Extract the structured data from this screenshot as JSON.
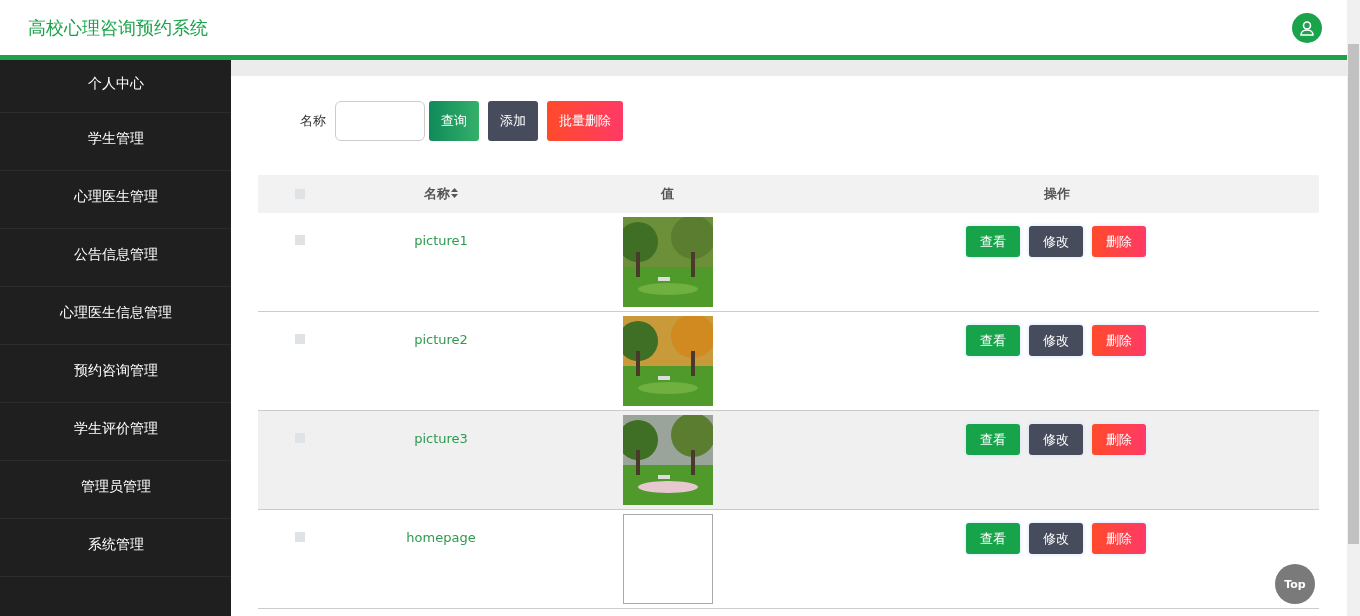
{
  "header": {
    "title": "高校心理咨询预约系统"
  },
  "sidebar": {
    "items": [
      {
        "label": "个人中心"
      },
      {
        "label": "学生管理"
      },
      {
        "label": "心理医生管理"
      },
      {
        "label": "公告信息管理"
      },
      {
        "label": "心理医生信息管理"
      },
      {
        "label": "预约咨询管理"
      },
      {
        "label": "学生评价管理"
      },
      {
        "label": "管理员管理"
      },
      {
        "label": "系统管理"
      }
    ]
  },
  "search": {
    "label": "名称",
    "buttons": [
      {
        "label": "查询",
        "kind": "query"
      },
      {
        "label": "添加",
        "kind": "add"
      },
      {
        "label": "批量删除",
        "kind": "delete"
      }
    ]
  },
  "table": {
    "select_all_checked": false,
    "columns": [
      "名称",
      "值",
      "操作"
    ],
    "rows": [
      {
        "checked": false,
        "highlighted": false,
        "name": "picture1",
        "value": {
          "kind": "picture"
        },
        "actions": [
          "查看",
          "修改",
          "删除"
        ]
      },
      {
        "checked": false,
        "highlighted": false,
        "name": "picture2",
        "value": {
          "kind": "picture"
        },
        "actions": [
          "查看",
          "修改",
          "删除"
        ]
      },
      {
        "checked": false,
        "highlighted": true,
        "name": "picture3",
        "value": {
          "kind": "picture"
        },
        "actions": [
          "查看",
          "修改",
          "删除"
        ]
      },
      {
        "checked": false,
        "highlighted": false,
        "name": "homepage",
        "value": {
          "kind": "broken"
        },
        "actions": [
          "查看",
          "修改",
          "删除"
        ]
      }
    ]
  },
  "top_button": {
    "label": "Top"
  }
}
